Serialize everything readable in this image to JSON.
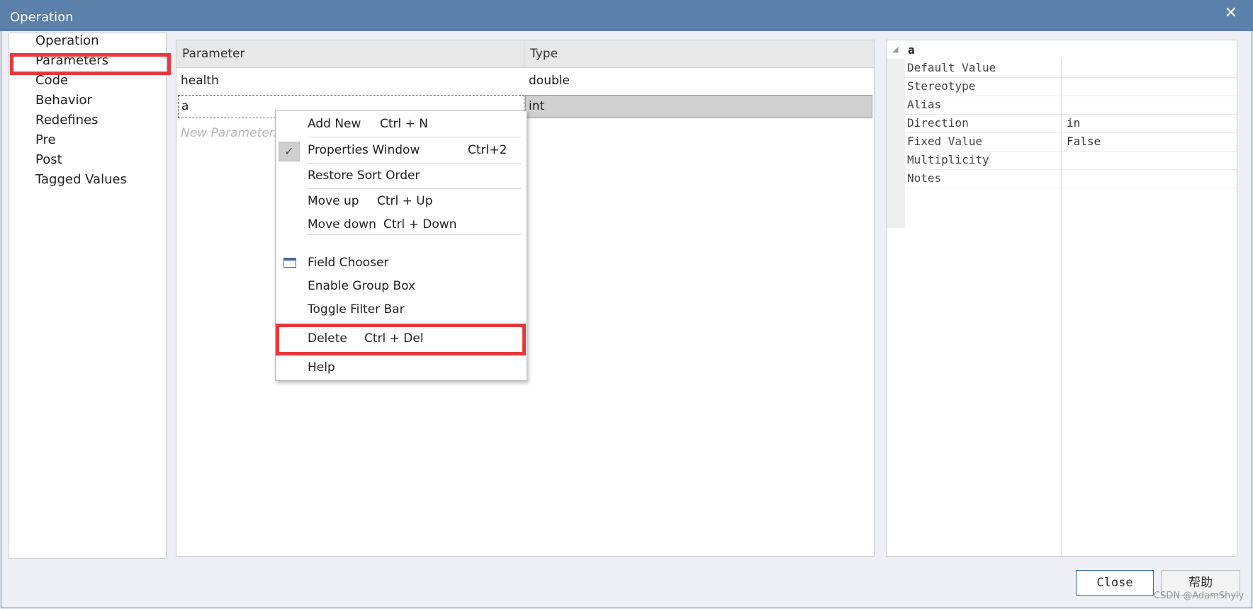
{
  "window": {
    "title": "Operation",
    "close_glyph": "✕"
  },
  "nav": {
    "items": [
      "Operation",
      "Parameters",
      "Code",
      "Behavior",
      "Redefines",
      "Pre",
      "Post",
      "Tagged Values"
    ],
    "selected": "Parameters"
  },
  "grid": {
    "columns": [
      "Parameter",
      "Type"
    ],
    "rows": [
      {
        "parameter": "health",
        "type": "double"
      },
      {
        "parameter": "a",
        "type": "int"
      }
    ],
    "new_placeholder": "New Parameter..."
  },
  "context_menu": {
    "items": [
      {
        "label": "Add New",
        "shortcut": "Ctrl + N"
      },
      {
        "label": "Properties Window",
        "shortcut": "Ctrl+2",
        "checked": true
      },
      {
        "label": "Restore Sort Order",
        "shortcut": ""
      },
      {
        "label": "Move up",
        "shortcut": "Ctrl + Up"
      },
      {
        "label": "Move down",
        "shortcut": "Ctrl + Down"
      },
      {
        "label": "Field Chooser",
        "shortcut": "",
        "icon": "window-icon"
      },
      {
        "label": "Enable Group Box",
        "shortcut": ""
      },
      {
        "label": "Toggle Filter Bar",
        "shortcut": ""
      },
      {
        "label": "Delete",
        "shortcut": "Ctrl + Del",
        "highlighted": true
      },
      {
        "label": "Help",
        "shortcut": ""
      }
    ],
    "check_glyph": "✓"
  },
  "properties": {
    "name": "a",
    "rows": [
      {
        "key": "Default Value",
        "value": ""
      },
      {
        "key": "Stereotype",
        "value": ""
      },
      {
        "key": "Alias",
        "value": ""
      },
      {
        "key": "Direction",
        "value": "in"
      },
      {
        "key": "Fixed Value",
        "value": "False"
      },
      {
        "key": "Multiplicity",
        "value": ""
      },
      {
        "key": "Notes",
        "value": ""
      }
    ]
  },
  "buttons": {
    "close": "Close",
    "help": "帮助"
  },
  "watermark": "CSDN @AdamShyly",
  "colors": {
    "titlebar": "#5b80a9",
    "highlight_box": "#e8373d",
    "selected_row": "#d0d0d0"
  }
}
